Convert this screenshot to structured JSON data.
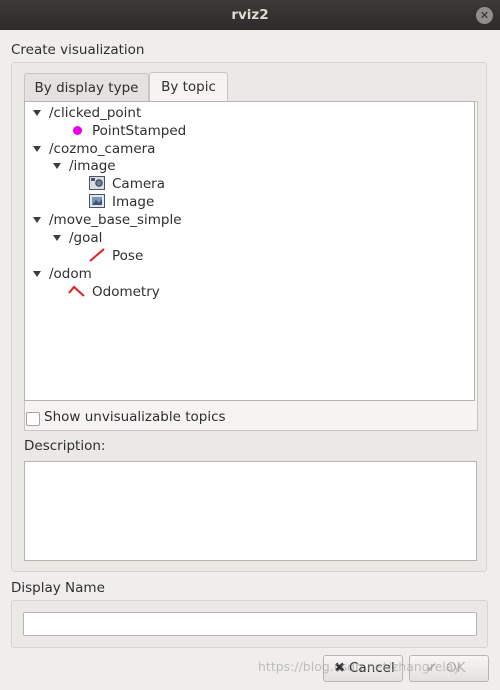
{
  "window": {
    "title": "rviz2"
  },
  "create_label": "Create visualization",
  "tabs": [
    {
      "label": "By display type",
      "active": false
    },
    {
      "label": "By topic",
      "active": true
    }
  ],
  "tree": {
    "clicked_point": {
      "label": "/clicked_point",
      "child": "PointStamped"
    },
    "cozmo_camera": {
      "label": "/cozmo_camera",
      "image": "/image",
      "camera": "Camera",
      "image_display": "Image"
    },
    "move_base_simple": {
      "label": "/move_base_simple",
      "goal": "/goal",
      "pose": "Pose"
    },
    "odom": {
      "label": "/odom",
      "child": "Odometry"
    }
  },
  "show_unvisualizable": {
    "label": "Show unvisualizable topics",
    "checked": false
  },
  "description": {
    "label": "Description:",
    "value": ""
  },
  "display_name": {
    "label": "Display Name",
    "value": ""
  },
  "buttons": {
    "cancel": "Cancel",
    "ok": "OK"
  },
  "watermark": "https://blog.csdn.net/zhangrelay",
  "colors": {
    "point_icon": "#e800e8",
    "pose_icon": "#e02020",
    "odometry_icon": "#e02020"
  }
}
